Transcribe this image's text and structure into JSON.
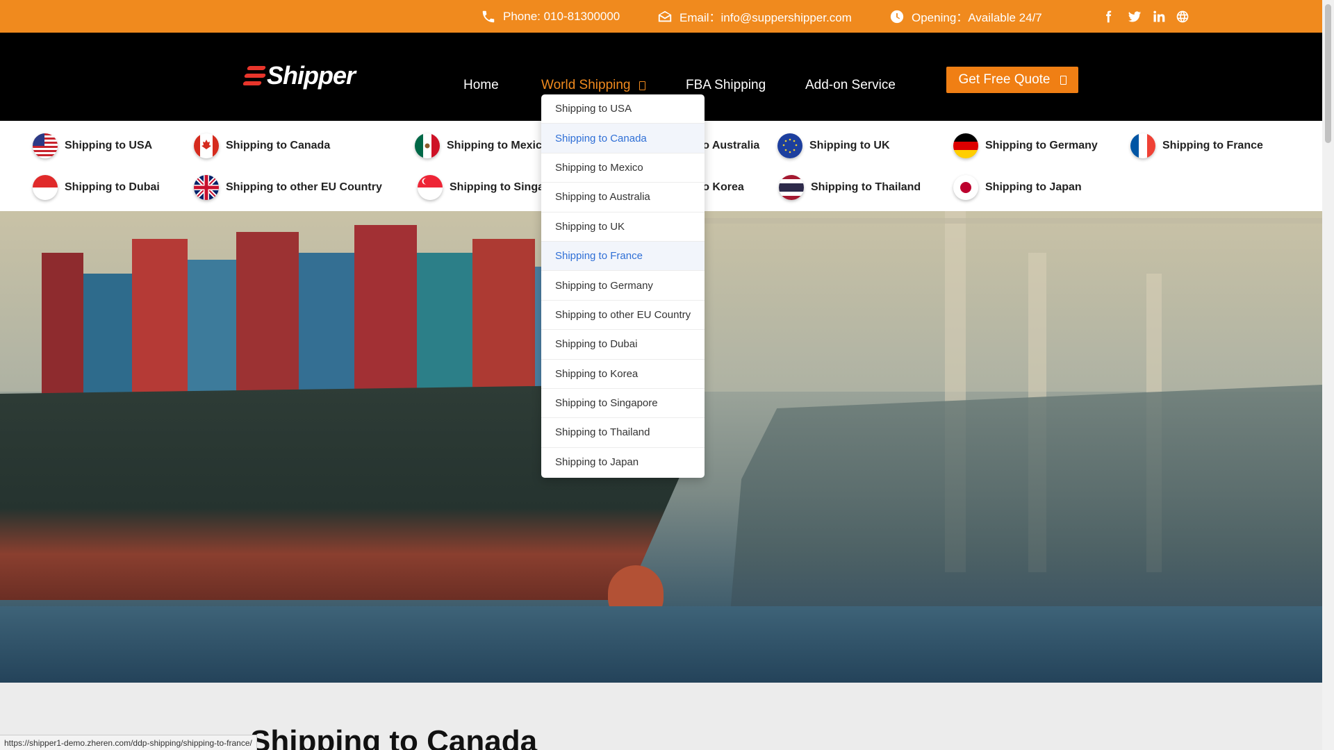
{
  "topbar": {
    "phone": "Phone: 010-81300000",
    "email": "Email：info@suppershipper.com",
    "opening": "Opening：Available 24/7",
    "social_icons": [
      "facebook-icon",
      "twitter-icon",
      "linkedin-icon",
      "globe-icon"
    ],
    "bg_color": "#f08a1e"
  },
  "header": {
    "logo_text": "Shipper",
    "nav": [
      {
        "label": "Home"
      },
      {
        "label": "World Shipping",
        "active": true
      },
      {
        "label": "FBA Shipping"
      },
      {
        "label": "Add-on Service"
      }
    ],
    "quote_label": "Get Free Quote",
    "accent_color": "#f08a1e"
  },
  "countries": [
    {
      "label": "Shipping to USA",
      "flag": "us-flag-icon"
    },
    {
      "label": "Shipping to Canada",
      "flag": "canada-flag-icon"
    },
    {
      "label": "Shipping to Mexico",
      "flag": "mexico-flag-icon"
    },
    {
      "label": "Shipping to Australia",
      "flag": "australia-flag-icon"
    },
    {
      "label": "Shipping to UK",
      "flag": "eu-flag-icon"
    },
    {
      "label": "Shipping to Germany",
      "flag": "germany-flag-icon"
    },
    {
      "label": "Shipping to France",
      "flag": "france-flag-icon"
    },
    {
      "label": "Shipping to Dubai",
      "flag": "dubai-flag-icon"
    },
    {
      "label": "Shipping to other EU Country",
      "flag": "uk-flag-icon"
    },
    {
      "label": "Shipping to Singapore",
      "flag": "singapore-flag-icon"
    },
    {
      "label": "Shipping to Korea",
      "flag": "korea-flag-icon"
    },
    {
      "label": "Shipping to Thailand",
      "flag": "thailand-flag-icon"
    },
    {
      "label": "Shipping to Japan",
      "flag": "japan-flag-icon"
    }
  ],
  "dropdown": {
    "items": [
      {
        "label": "Shipping to USA"
      },
      {
        "label": "Shipping to Canada",
        "highlight": true
      },
      {
        "label": "Shipping to Mexico"
      },
      {
        "label": "Shipping to Australia"
      },
      {
        "label": "Shipping to UK"
      },
      {
        "label": "Shipping to France",
        "highlight": true
      },
      {
        "label": "Shipping to Germany"
      },
      {
        "label": "Shipping to other EU Country"
      },
      {
        "label": "Shipping to Dubai"
      },
      {
        "label": "Shipping to Korea"
      },
      {
        "label": "Shipping to Singapore"
      },
      {
        "label": "Shipping to Thailand"
      },
      {
        "label": "Shipping to Japan"
      }
    ],
    "highlight_color": "#2f6fd6"
  },
  "section": {
    "title": "Shipping to Canada"
  },
  "status_url": "https://shipper1-demo.zheren.com/ddp-shipping/shipping-to-france/"
}
